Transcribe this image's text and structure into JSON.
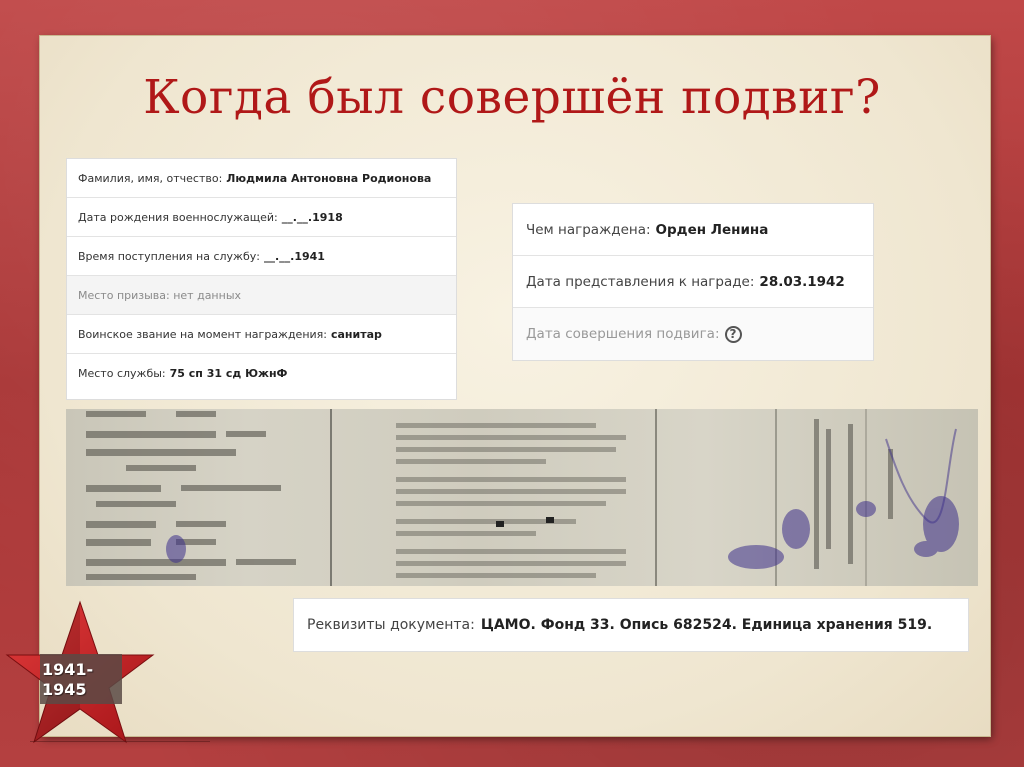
{
  "slide": {
    "title": "Когда был совершён подвиг?"
  },
  "person": {
    "rows": [
      {
        "label": "Фамилия, имя, отчество:",
        "value": "Людмила Антоновна Родионова"
      },
      {
        "label": "Дата рождения военнослужащей:",
        "value": "__.__.1918"
      },
      {
        "label": "Время поступления на службу:",
        "value": "__.__.1941"
      },
      {
        "label": "Место призыва: нет данных",
        "value": ""
      },
      {
        "label": "Воинское звание на момент награждения:",
        "value": "санитар"
      },
      {
        "label": "Место службы:",
        "value": "75 сп 31 сд ЮжнФ"
      }
    ]
  },
  "award": {
    "award_label": "Чем награждена:",
    "award_value": "Орден Ленина",
    "date_label": "Дата представления к награде:",
    "date_value": "28.03.1942",
    "feat_label": "Дата совершения подвига:",
    "feat_icon": "question-circle-icon"
  },
  "document": {
    "label": "Реквизиты документа:",
    "value": "ЦАМО. Фонд 33. Опись 682524. Единица хранения 519."
  },
  "badge": {
    "years_line1": "1941-",
    "years_line2": "1945",
    "icon": "red-star-icon"
  },
  "colors": {
    "title": "#b01818",
    "frame": "#b03a3a",
    "slide_bg": "#f3ecda",
    "star": "#c8232a"
  }
}
